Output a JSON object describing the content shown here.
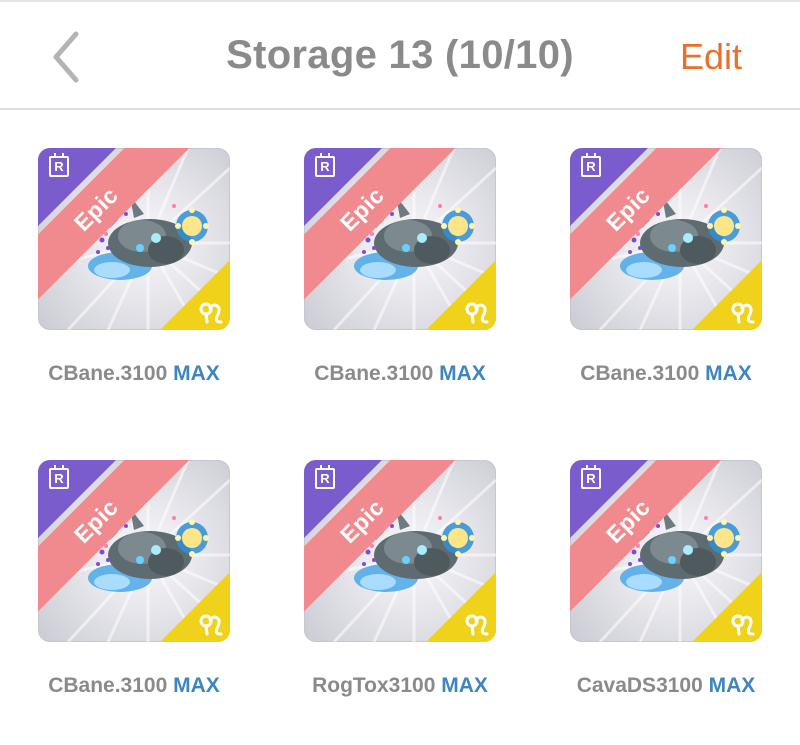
{
  "header": {
    "back_icon": "chevron-left-icon",
    "title": "Storage 13 (10/10)",
    "edit_label": "Edit",
    "edit_color": "#e8702a"
  },
  "items": [
    {
      "rarity": "Epic",
      "name": "CBane.3100",
      "level": "MAX",
      "badge": "R",
      "sign_icon": "leo-icon"
    },
    {
      "rarity": "Epic",
      "name": "CBane.3100",
      "level": "MAX",
      "badge": "R",
      "sign_icon": "leo-icon"
    },
    {
      "rarity": "Epic",
      "name": "CBane.3100",
      "level": "MAX",
      "badge": "R",
      "sign_icon": "leo-icon"
    },
    {
      "rarity": "Epic",
      "name": "CBane.3100",
      "level": "MAX",
      "badge": "R",
      "sign_icon": "leo-icon"
    },
    {
      "rarity": "Epic",
      "name": "RogTox3100",
      "level": "MAX",
      "badge": "R",
      "sign_icon": "leo-icon"
    },
    {
      "rarity": "Epic",
      "name": "CavaDS3100",
      "level": "MAX",
      "badge": "R",
      "sign_icon": "leo-icon"
    }
  ],
  "colors": {
    "epic_banner": "#f08a8f",
    "rarity_corner": "#7b5ccc",
    "sign_corner": "#f1d21a",
    "name_text": "#8a8a8a",
    "max_text": "#3f86c0"
  }
}
